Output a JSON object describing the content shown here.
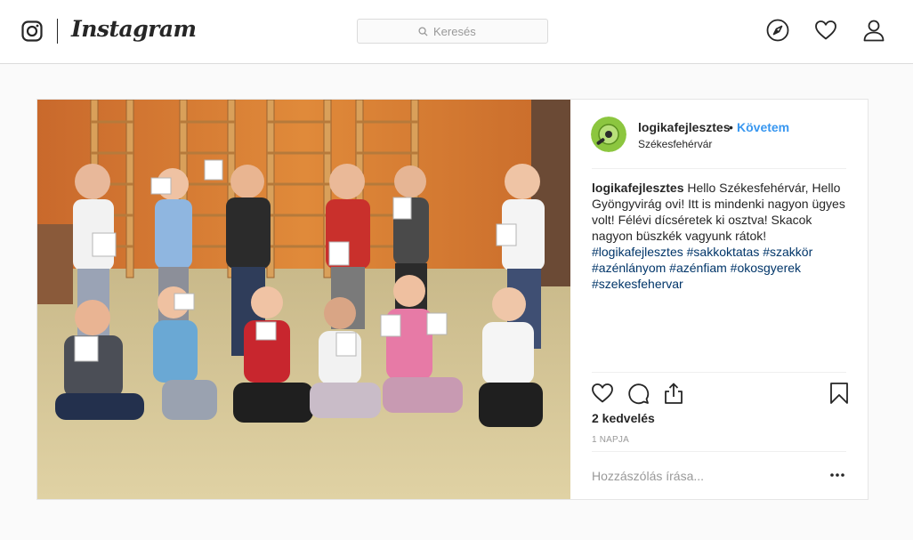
{
  "nav": {
    "brand": "Instagram",
    "search_placeholder": "Keresés",
    "icons": [
      "camera-logo-icon",
      "search-icon",
      "compass-icon",
      "heart-icon",
      "user-icon"
    ]
  },
  "post": {
    "username": "logikafejlesztes",
    "separator": "•",
    "follow_label": "Követem",
    "location": "Székesfehérvár",
    "caption_user": "logikafejlesztes",
    "caption_text": "Hello Székesfehérvár, Hello Gyöngyvirág ovi! Itt is mindenki nagyon ügyes volt! Félévi dícséretek ki osztva! Skacok nagyon büszkék vagyunk rátok!",
    "hashtags": [
      "#logikafejlesztes",
      "#sakkoktatas",
      "#szakkör",
      "#azénlányom",
      "#azénfiam",
      "#okosgyerek",
      "#szekesfehervar"
    ],
    "likes": "2 kedvelés",
    "time": "1 NAPJA",
    "comment_placeholder": "Hozzászólás írása...",
    "action_icons": [
      "heart-icon",
      "comment-icon",
      "share-icon",
      "bookmark-icon",
      "more-icon"
    ]
  },
  "colors": {
    "link": "#3897f0",
    "hashtag": "#003569",
    "border": "#dbdbdb",
    "avatar": "#8cc63f"
  }
}
